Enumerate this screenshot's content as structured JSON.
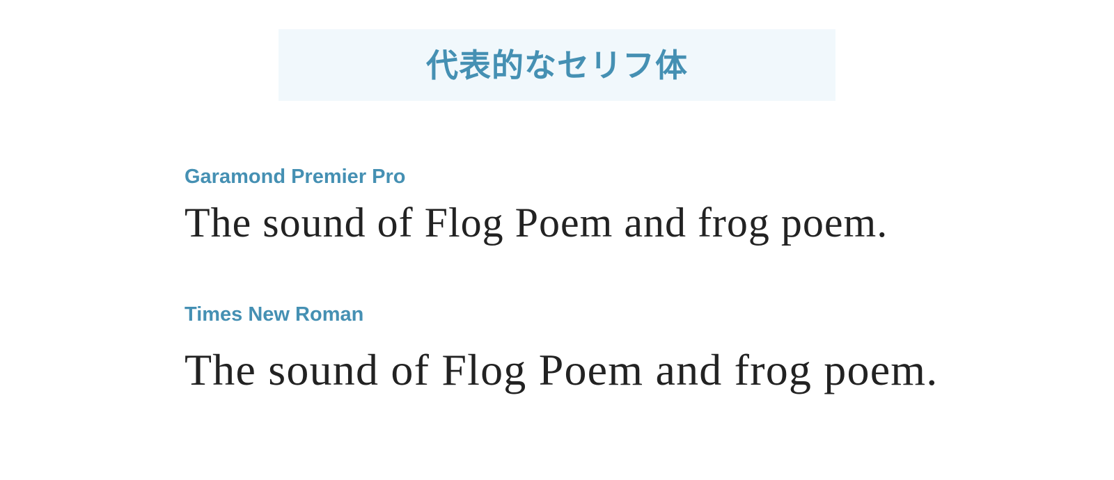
{
  "title": "代表的なセリフ体",
  "samples": [
    {
      "font_name": "Garamond Premier Pro",
      "sample_text": "The sound of Flog Poem and frog poem."
    },
    {
      "font_name": "Times New Roman",
      "sample_text": "The sound of Flog Poem and frog poem."
    }
  ],
  "colors": {
    "accent": "#4590b3",
    "banner_background": "#f1f8fc",
    "sample_text": "#222222",
    "page_background": "#ffffff"
  }
}
